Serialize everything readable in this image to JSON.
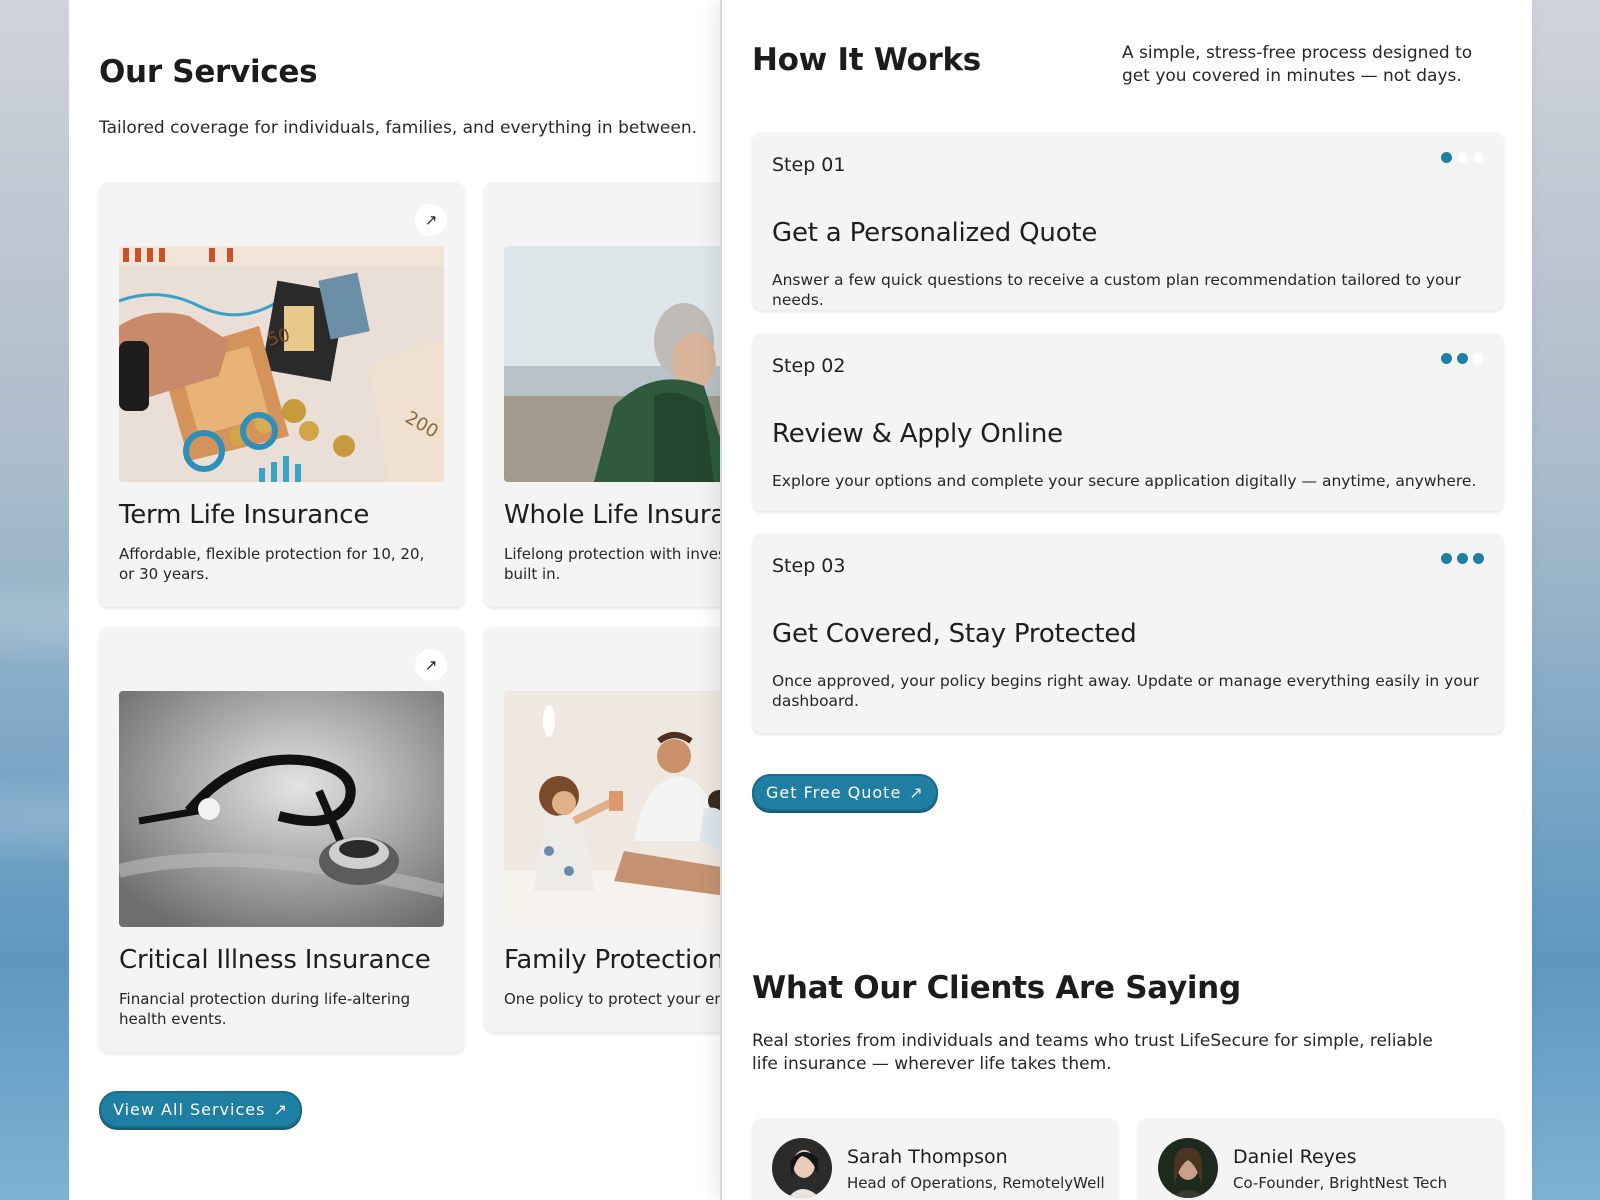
{
  "services": {
    "title": "Our Services",
    "subtitle": "Tailored coverage for individuals, families, and everything in between.",
    "cards": [
      {
        "title": "Term Life Insurance",
        "description": "Affordable, flexible protection for 10, 20, or 30 years.",
        "arrow": "↗"
      },
      {
        "title": "Whole Life Insurance",
        "description": "Lifelong protection with investment value built in.",
        "arrow": "↗"
      },
      {
        "title": "Critical Illness Insurance",
        "description": "Financial protection during life-altering health events.",
        "arrow": "↗"
      },
      {
        "title": "Family Protection Plan",
        "description": "One policy to protect your entire family.",
        "arrow": "↗"
      }
    ],
    "view_all_label": "View All Services",
    "view_all_icon": "↗"
  },
  "how_it_works": {
    "title": "How It Works",
    "subtitle": "A simple, stress-free process designed to get you covered in minutes — not days.",
    "steps": [
      {
        "label": "Step 01",
        "title": "Get a Personalized Quote",
        "description": "Answer a few quick questions to receive a custom plan recommendation tailored to your needs.",
        "dots_active": 1
      },
      {
        "label": "Step 02",
        "title": "Review & Apply Online",
        "description": "Explore your options and complete your secure application digitally — anytime, anywhere.",
        "dots_active": 2
      },
      {
        "label": "Step 03",
        "title": "Get Covered, Stay Protected",
        "description": "Once approved, your policy begins right away. Update or manage everything easily in your dashboard.",
        "dots_active": 3
      }
    ],
    "cta_label": "Get Free Quote",
    "cta_icon": "↗"
  },
  "testimonials": {
    "title": "What Our Clients Are Saying",
    "subtitle": "Real stories from individuals and teams who trust LifeSecure for simple, reliable life insurance — wherever life takes them.",
    "people": [
      {
        "name": "Sarah Thompson",
        "role": "Head of Operations, RemotelyWell"
      },
      {
        "name": "Daniel Reyes",
        "role": "Co-Founder, BrightNest Tech"
      }
    ]
  },
  "colors": {
    "accent": "#1f7fa3",
    "card": "#f4f4f4"
  }
}
